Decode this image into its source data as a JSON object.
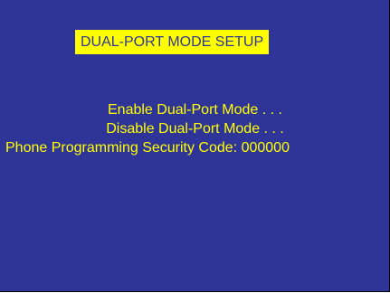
{
  "screen": {
    "title": "DUAL-PORT MODE SETUP",
    "colors": {
      "background": "#2f3598",
      "title_highlight": "#ffff00",
      "title_text": "#2f3598",
      "menu_text": "#ffff00"
    },
    "menu": {
      "enable": "Enable Dual-Port Mode . . .",
      "disable": "Disable Dual-Port Mode . . .",
      "security_code": "Phone Programming Security Code: 000000"
    }
  }
}
